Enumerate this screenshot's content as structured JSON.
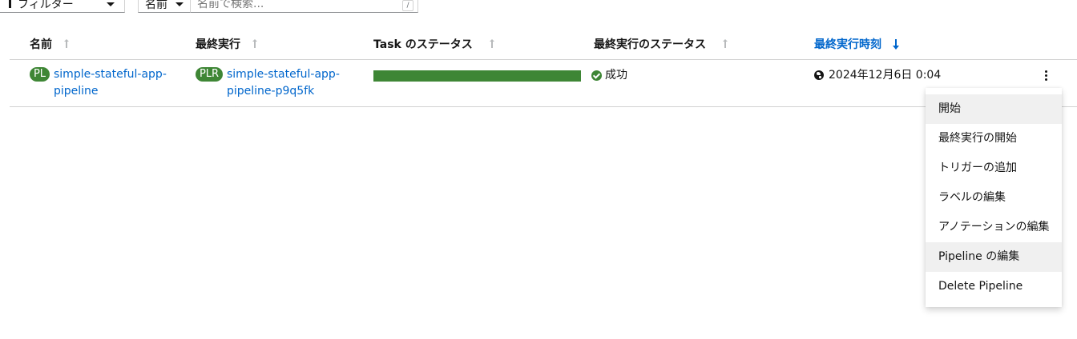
{
  "toolbar": {
    "filter_label": "フィルター",
    "search_select_label": "名前",
    "search_placeholder": "名前で検索...",
    "search_shortcut": "/"
  },
  "table": {
    "headers": [
      {
        "label": "名前",
        "sorted": false
      },
      {
        "label": "最終実行",
        "sorted": false
      },
      {
        "label": "Task のステータス",
        "sorted": false
      },
      {
        "label": "最終実行のステータス",
        "sorted": false
      },
      {
        "label": "最終実行時刻",
        "sorted": true,
        "direction": "descending"
      }
    ],
    "rows": [
      {
        "name_badge": "PL",
        "name_line1": "simple-stateful-app-",
        "name_line2": "pipeline",
        "last_run_badge": "PLR",
        "last_run_line1": "simple-stateful-app-",
        "last_run_line2": "pipeline-p9q5fk",
        "task_status_progress": 1.0,
        "last_run_status": "成功",
        "last_run_time": "2024年12月6日 0:04"
      }
    ]
  },
  "menu": {
    "items": [
      {
        "label": "開始",
        "highlighted": true
      },
      {
        "label": "最終実行の開始",
        "highlighted": false
      },
      {
        "label": "トリガーの追加",
        "highlighted": false
      },
      {
        "label": "ラベルの編集",
        "highlighted": false
      },
      {
        "label": "アノテーションの編集",
        "highlighted": false
      },
      {
        "label": "Pipeline の編集",
        "highlighted": true
      },
      {
        "label": "Delete Pipeline",
        "highlighted": false
      }
    ]
  },
  "colors": {
    "success": "#3e8635",
    "link": "#0066cc",
    "border": "#d2d2d2",
    "menu_hover": "#f0f0f0"
  },
  "icons": [
    "filter-icon",
    "chevron-down-icon",
    "sort-icon",
    "sort-descending-icon",
    "check-circle-icon",
    "globe-icon",
    "kebab-icon"
  ]
}
